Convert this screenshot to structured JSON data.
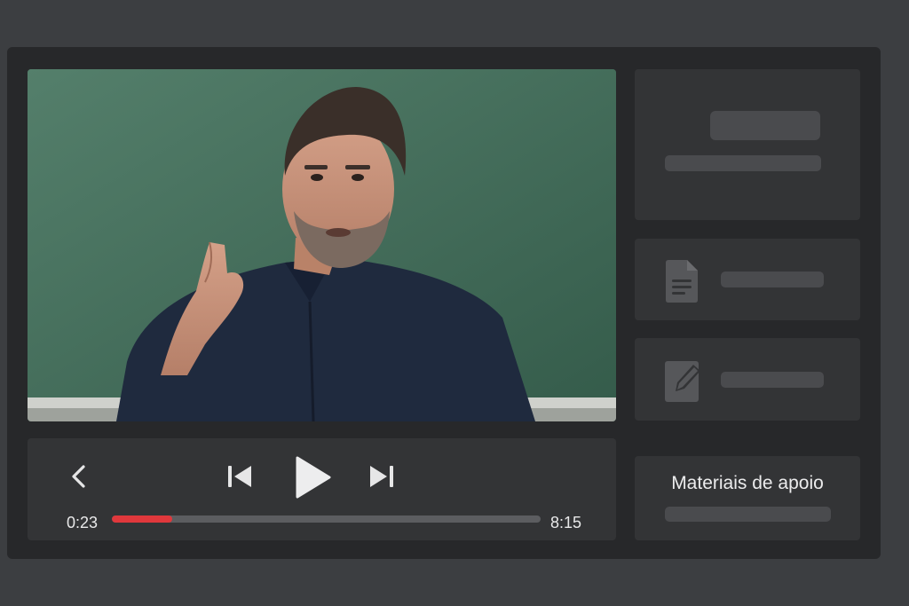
{
  "player": {
    "current_time": "0:23",
    "total_time": "8:15",
    "progress": 0.14,
    "accent_color": "#e0383c",
    "icons": {
      "back": "chevron-left-icon",
      "previous": "skip-previous-icon",
      "play": "play-icon",
      "next": "skip-next-icon"
    }
  },
  "sidebar": {
    "cards": [
      {
        "icon": "none"
      },
      {
        "icon": "document-icon"
      },
      {
        "icon": "edit-icon"
      },
      {
        "title": "Materiais de apoio"
      }
    ]
  }
}
